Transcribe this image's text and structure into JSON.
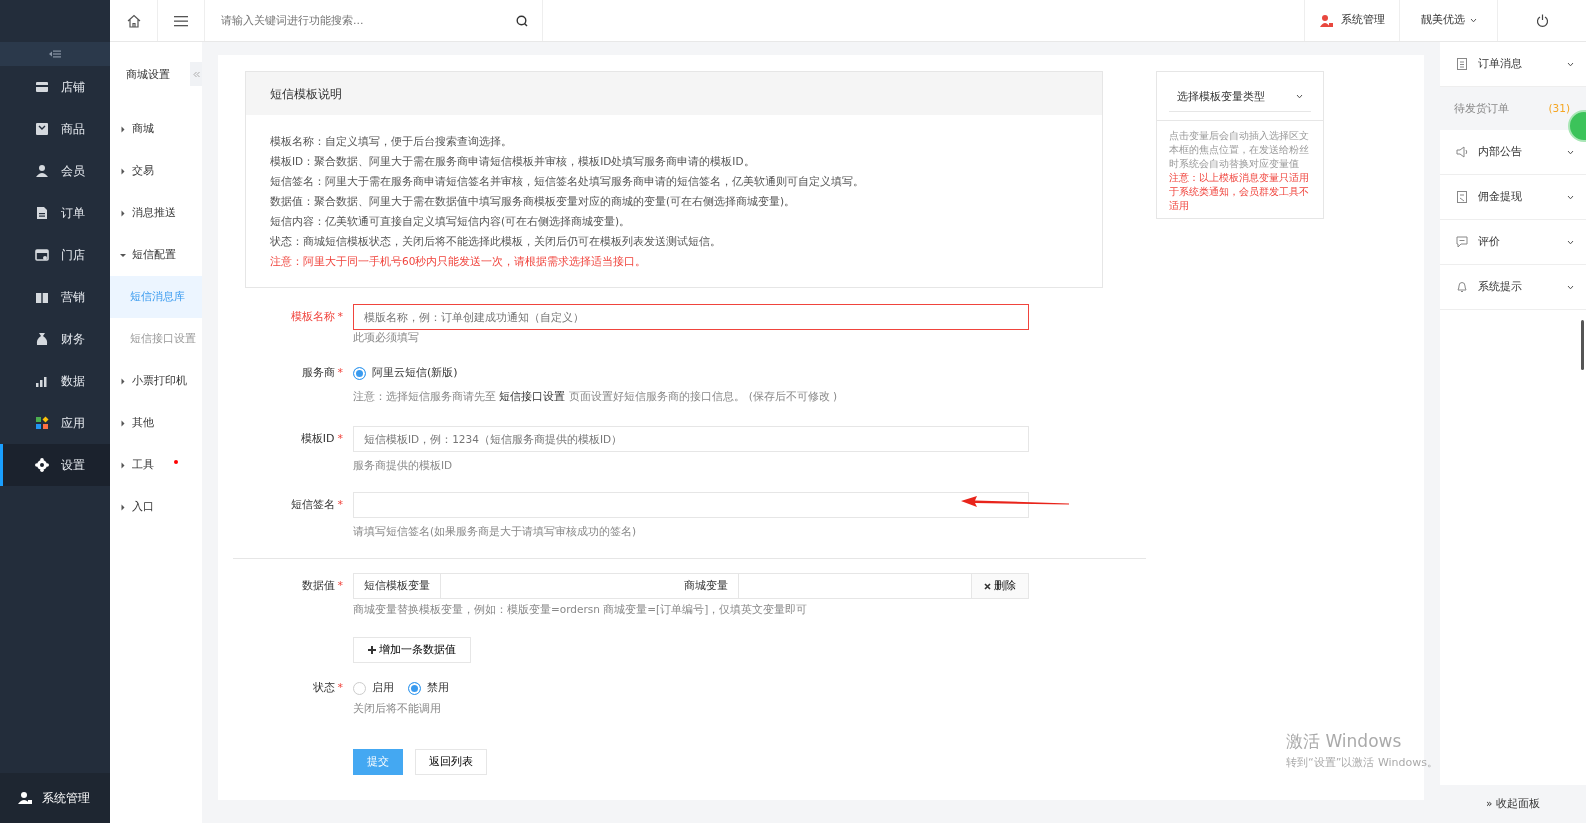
{
  "top_bar": {
    "search": {
      "placeholder": "请输入关键词进行功能搜索..."
    },
    "admin_menu": "系统管理",
    "store_menu": "靓美优选"
  },
  "main_nav": {
    "items": [
      {
        "label": "店铺",
        "selected": false
      },
      {
        "label": "商品",
        "selected": false
      },
      {
        "label": "会员",
        "selected": false
      },
      {
        "label": "订单",
        "selected": false
      },
      {
        "label": "门店",
        "selected": false
      },
      {
        "label": "营销",
        "selected": false
      },
      {
        "label": "财务",
        "selected": false
      },
      {
        "label": "数据",
        "selected": false
      },
      {
        "label": "应用",
        "selected": false
      },
      {
        "label": "设置",
        "selected": true
      }
    ],
    "footer": "系统管理"
  },
  "sub_nav": {
    "title": "商城设置",
    "items": [
      {
        "label": "商城",
        "expanded": false,
        "notify": false
      },
      {
        "label": "交易",
        "expanded": false,
        "notify": false
      },
      {
        "label": "消息推送",
        "expanded": false,
        "notify": false
      },
      {
        "label": "短信配置",
        "expanded": true,
        "notify": false,
        "children": [
          {
            "label": "短信消息库",
            "selected": true
          },
          {
            "label": "短信接口设置",
            "selected": false
          }
        ]
      },
      {
        "label": "小票打印机",
        "expanded": false,
        "notify": false
      },
      {
        "label": "其他",
        "expanded": false,
        "notify": false
      },
      {
        "label": "工具",
        "expanded": false,
        "notify": true
      },
      {
        "label": "入口",
        "expanded": false,
        "notify": false
      }
    ]
  },
  "notice": {
    "title": "短信模板说明",
    "lines": [
      {
        "kind": "plain",
        "text": "模板名称：自定义填写，便于后台搜索查询选择。"
      },
      {
        "kind": "plain",
        "text": "模板ID：聚合数据、阿里大于需在服务商申请短信模板并审核，模板ID处填写服务商申请的模板ID。"
      },
      {
        "kind": "plain",
        "text": "短信签名：阿里大于需在服务商申请短信签名并审核，短信签名处填写服务商申请的短信签名，亿美软通则可自定义填写。"
      },
      {
        "kind": "plain",
        "text": "数据值：聚合数据、阿里大于需在数据值中填写服务商模板变量对应的商城的变量(可在右侧选择商城变量)。"
      },
      {
        "kind": "plain",
        "text": "短信内容：亿美软通可直接自定义填写短信内容(可在右侧选择商城变量)。"
      },
      {
        "kind": "plain",
        "text": "状态：商城短信模板状态，关闭后将不能选择此模板，关闭后仍可在模板列表发送测试短信。"
      },
      {
        "kind": "warning",
        "text": "注意：阿里大于同一手机号60秒内只能发送一次，请根据需求选择适当接口。"
      }
    ]
  },
  "variable_panel": {
    "select_label": "选择模板变量类型",
    "hint": "点击变量后会自动插入选择区文本框的焦点位置，在发送给粉丝时系统会自动替换对应变量值",
    "warning": "注意：以上模板消息变量只适用于系统类通知，会员群发工具不适用"
  },
  "form": {
    "name_field": {
      "label": "模板名称",
      "required_mark": "*",
      "invalid": true,
      "placeholder": "模版名称，例：订单创建成功通知（自定义）",
      "error": "此项必须填写"
    },
    "provider": {
      "label": "服务商",
      "required_mark": "*",
      "options": [
        {
          "label": "阿里云短信(新版)",
          "selected": true
        }
      ],
      "hint": "注意：选择短信服务商请先至 **短信接口设置** 页面设置好短信服务商的接口信息。",
      "hint_warning": "(保存后不可修改 )"
    },
    "template_id": {
      "label": "模板ID",
      "required_mark": "*",
      "placeholder": "短信模板ID，例：1234（短信服务商提供的模板ID）",
      "hint": "服务商提供的模板ID"
    },
    "signature": {
      "label": "短信签名",
      "required_mark": "*",
      "hint": "请填写短信签名(如果服务商是大于请填写审核成功的签名)"
    },
    "data_value": {
      "label": "数据值",
      "required_mark": "*",
      "template_var_label": "短信模板变量",
      "shop_var_label": "商城变量",
      "delete_button": "删除",
      "hint": "商城变量替换模板变量，例如：模版变量=ordersn 商城变量=[订单编号]，",
      "hint_warning": "仅填英文变量即可",
      "add_button": "增加一条数据值"
    },
    "status": {
      "label": "状态",
      "required_mark": "*",
      "options": [
        {
          "label": "启用",
          "selected": false
        },
        {
          "label": "禁用",
          "selected": true
        }
      ],
      "hint": "关闭后将不能调用"
    },
    "submit_button": "提交",
    "back_button": "返回列表"
  },
  "right_panel": {
    "sections": [
      {
        "label": "订单消息",
        "children": [
          {
            "label": "待发货订单",
            "count": "(31)"
          }
        ]
      },
      {
        "label": "内部公告"
      },
      {
        "label": "佣金提现"
      },
      {
        "label": "评价"
      },
      {
        "label": "系统提示"
      }
    ],
    "collapse": "» 收起面板"
  },
  "os_notice": {
    "title": "激活 Windows",
    "text": "转到“设置”以激活 Windows。"
  }
}
